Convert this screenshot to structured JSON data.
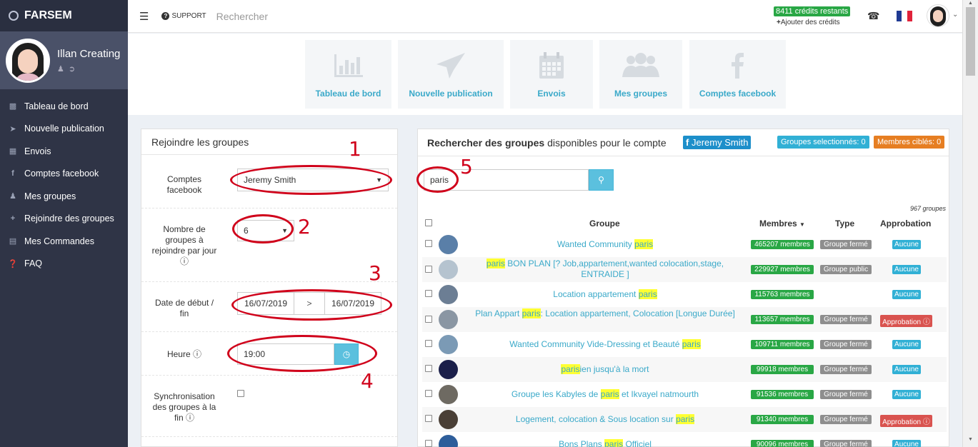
{
  "brand": {
    "name": "FARSEM"
  },
  "user": {
    "name": "Illan Creating"
  },
  "nav": [
    {
      "label": "Tableau de bord",
      "icon": "bar-chart-icon"
    },
    {
      "label": "Nouvelle publication",
      "icon": "paper-plane-icon"
    },
    {
      "label": "Envois",
      "icon": "calendar-icon"
    },
    {
      "label": "Comptes facebook",
      "icon": "facebook-icon"
    },
    {
      "label": "Mes groupes",
      "icon": "users-icon"
    },
    {
      "label": "Rejoindre des groupes",
      "icon": "plus-icon"
    },
    {
      "label": "Mes Commandes",
      "icon": "list-icon"
    },
    {
      "label": "FAQ",
      "icon": "question-icon"
    }
  ],
  "topbar": {
    "support": "SUPPORT",
    "search_placeholder": "Rechercher",
    "credits": "8411 crédits restants",
    "add_credits": "Ajouter des crédits"
  },
  "tiles": [
    {
      "label": "Tableau de bord"
    },
    {
      "label": "Nouvelle publication"
    },
    {
      "label": "Envois"
    },
    {
      "label": "Mes groupes"
    },
    {
      "label": "Comptes facebook"
    }
  ],
  "join_panel": {
    "title": "Rejoindre les groupes",
    "account_label": "Comptes facebook",
    "account_value": "Jeremy Smith",
    "per_day_label": "Nombre de groupes à rejoindre par jour",
    "per_day_value": "6",
    "dates_label": "Date de début / fin",
    "date_start": "16/07/2019",
    "date_end": "16/07/2019",
    "date_sep": ">",
    "time_label": "Heure",
    "time_value": "19:00",
    "sync_label": "Synchronisation des groupes à la fin"
  },
  "annotations": [
    "1",
    "2",
    "3",
    "4",
    "5"
  ],
  "search_panel": {
    "title_bold": "Rechercher des groupes",
    "title_rest": "disponibles pour le compte",
    "account_badge": "Jeremy Smith",
    "selected_badge": "Groupes selectionnés: 0",
    "targeted_badge": "Membres ciblés: 0",
    "query": "paris",
    "count": "967 groupes",
    "columns": {
      "group": "Groupe",
      "members": "Membres",
      "type": "Type",
      "approval": "Approbation"
    },
    "rows": [
      {
        "pre": "Wanted Community ",
        "hl": "paris",
        "post": "",
        "members": "465207 membres",
        "type": "Groupe fermé",
        "approval": "Aucune",
        "thumb": "#5a7fa8"
      },
      {
        "pre": "",
        "hl": "paris",
        "post": " BON PLAN [? Job,appartement,wanted colocation,stage, ENTRAIDE ]",
        "members": "229927 membres",
        "type": "Groupe public",
        "approval": "Aucune",
        "thumb": "#b5c3cf"
      },
      {
        "pre": "Location appartement ",
        "hl": "paris",
        "post": "",
        "members": "115763 membres",
        "type": "",
        "approval": "Aucune",
        "thumb": "#6c7e94"
      },
      {
        "pre": "Plan Appart ",
        "hl": "paris",
        "post": ": Location appartement, Colocation [Longue Durée]",
        "members": "113657 membres",
        "type": "Groupe fermé",
        "approval": "Approbation",
        "thumb": "#8a96a3"
      },
      {
        "pre": "Wanted Community Vide-Dressing et Beauté ",
        "hl": "paris",
        "post": "",
        "members": "109711 membres",
        "type": "Groupe fermé",
        "approval": "Aucune",
        "thumb": "#7b9ab5"
      },
      {
        "pre": "",
        "hl": "paris",
        "post": "ien jusqu'à la mort",
        "members": "99918 membres",
        "type": "Groupe fermé",
        "approval": "Aucune",
        "thumb": "#1b1f4a"
      },
      {
        "pre": "Groupe les Kabyles de ",
        "hl": "paris",
        "post": " et Ikvayel natmourth",
        "members": "91536 membres",
        "type": "Groupe fermé",
        "approval": "Aucune",
        "thumb": "#6e6a62"
      },
      {
        "pre": "Logement, colocation & Sous location sur ",
        "hl": "paris",
        "post": "",
        "members": "91340 membres",
        "type": "Groupe fermé",
        "approval": "Approbation",
        "thumb": "#4a3f36"
      },
      {
        "pre": "Bons Plans ",
        "hl": "paris",
        "post": " Officiel",
        "members": "90096 membres",
        "type": "Groupe fermé",
        "approval": "Aucune",
        "thumb": "#2d5d9a"
      }
    ]
  },
  "colors": {
    "sidebar": "#2f3446",
    "accent": "#3aa9c9",
    "annotation": "#d0021b"
  }
}
